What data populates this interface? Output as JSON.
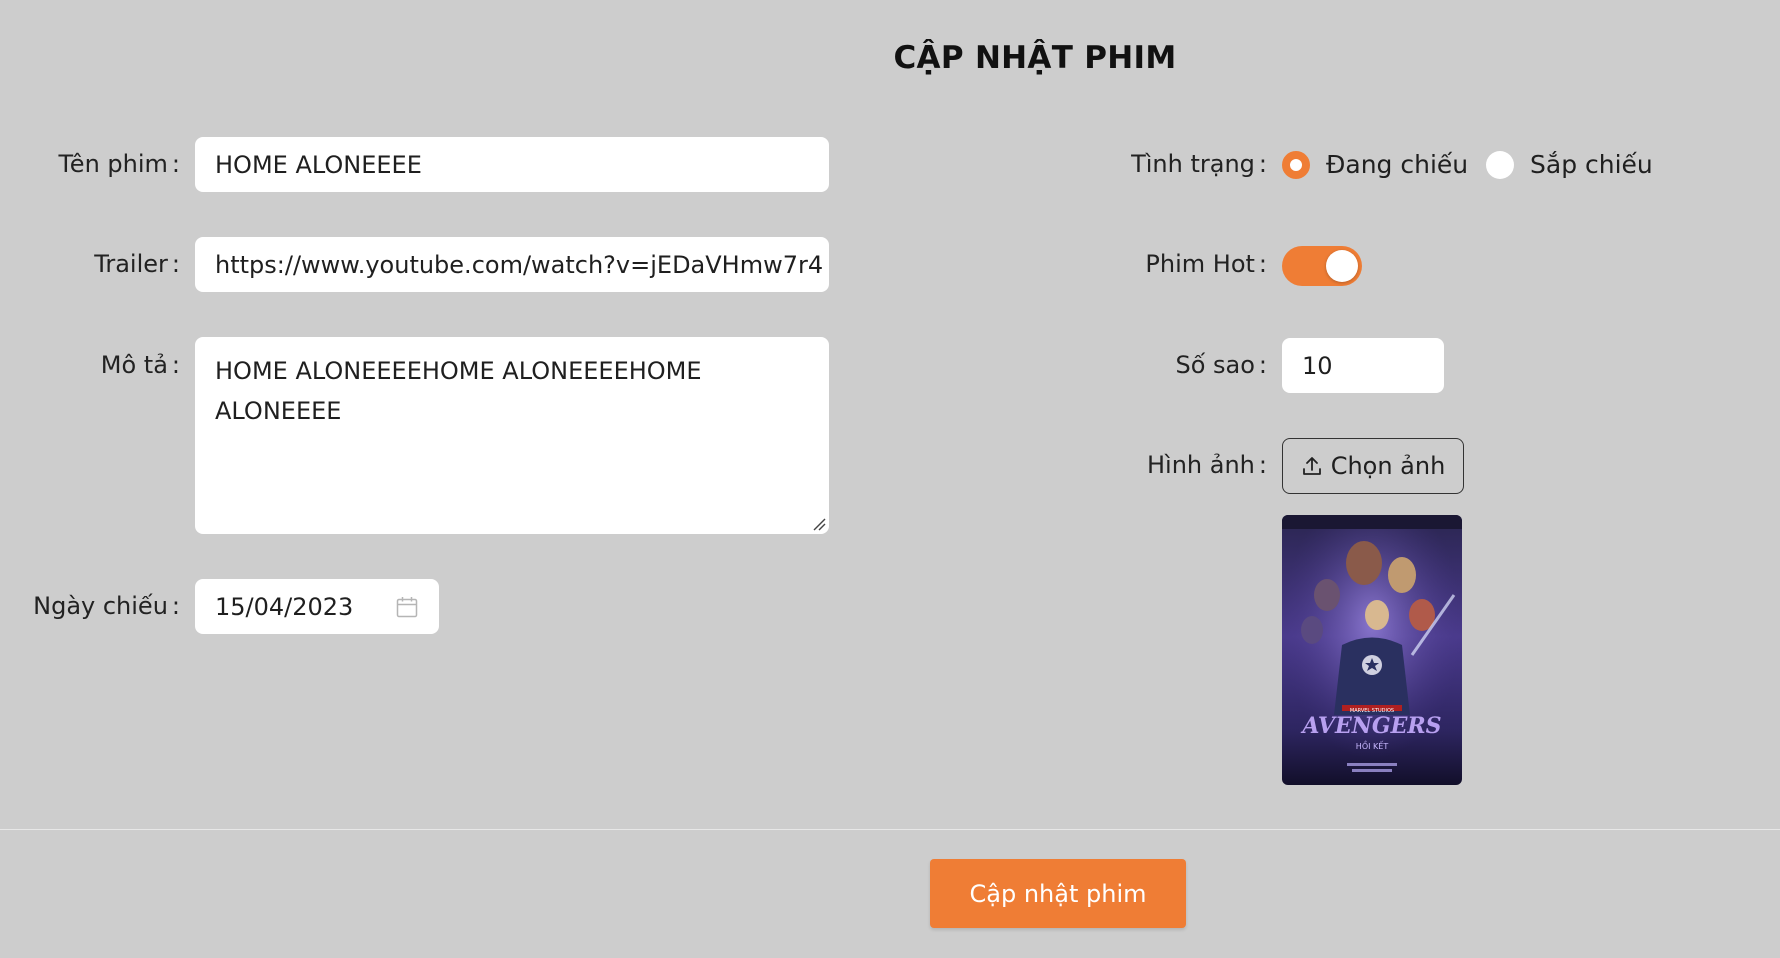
{
  "page_title": "CẬP NHẬT PHIM",
  "form": {
    "name": {
      "label": "Tên phim",
      "value": "HOME ALONEEEE"
    },
    "trailer": {
      "label": "Trailer",
      "value": "https://www.youtube.com/watch?v=jEDaVHmw7r4"
    },
    "description": {
      "label": "Mô tả",
      "value": "HOME ALONEEEEHOME ALONEEEEHOME ALONEEEE"
    },
    "release_date": {
      "label": "Ngày chiếu",
      "value": "15/04/2023",
      "icon": "calendar-icon"
    },
    "status": {
      "label": "Tình trạng",
      "options": [
        {
          "label": "Đang chiếu",
          "checked": true
        },
        {
          "label": "Sắp chiếu",
          "checked": false
        }
      ]
    },
    "hot": {
      "label": "Phim Hot",
      "on": true
    },
    "rating": {
      "label": "Số sao",
      "value": "10"
    },
    "image": {
      "label": "Hình ảnh",
      "button_label": "Chọn ảnh",
      "button_icon": "upload-icon",
      "preview_title": "AVENGERS",
      "preview_subtitle": "HỒI KẾT",
      "preview_studio": "MARVEL STUDIOS"
    }
  },
  "submit_label": "Cập nhật phim",
  "colors": {
    "background": "#cdcdcd",
    "accent": "#ef7d35",
    "input_bg": "#ffffff"
  },
  "colon": ":"
}
